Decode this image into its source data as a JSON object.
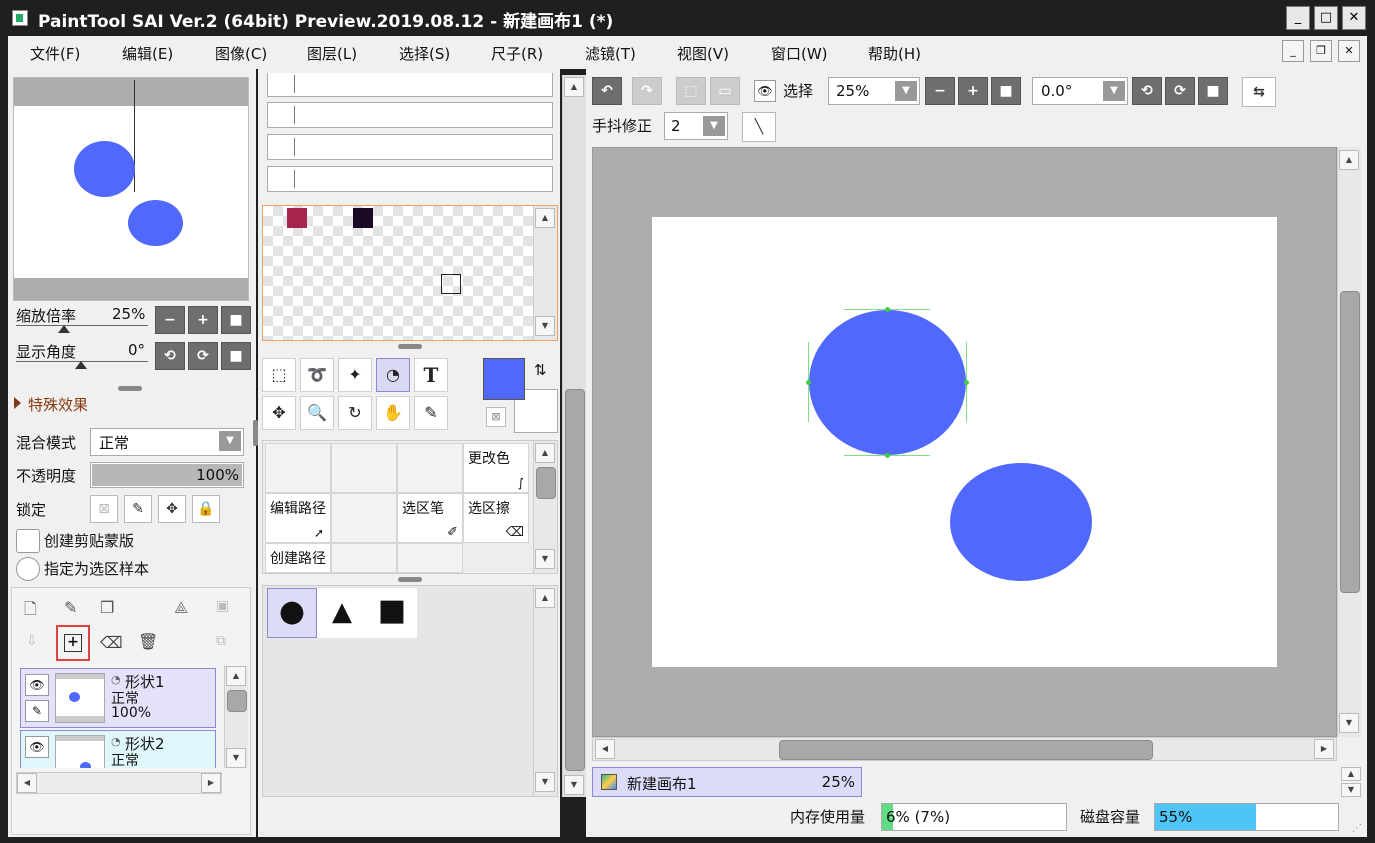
{
  "window": {
    "title": "PaintTool SAI Ver.2 (64bit) Preview.2019.08.12 - 新建画布1 (*)",
    "min": "_",
    "max": "□",
    "close": "✕"
  },
  "menu": [
    {
      "label": "文件(F)"
    },
    {
      "label": "编辑(E)"
    },
    {
      "label": "图像(C)"
    },
    {
      "label": "图层(L)"
    },
    {
      "label": "选择(S)"
    },
    {
      "label": "尺子(R)"
    },
    {
      "label": "滤镜(T)"
    },
    {
      "label": "视图(V)"
    },
    {
      "label": "窗口(W)"
    },
    {
      "label": "帮助(H)"
    }
  ],
  "mdi": {
    "min": "_",
    "restore": "❐",
    "close": "✕"
  },
  "navigator": {
    "zoom_label": "缩放倍率",
    "zoom_value": "25%",
    "angle_label": "显示角度",
    "angle_value": "0°",
    "zoom_out": "−",
    "zoom_in": "+",
    "zoom_reset": "■",
    "rot_ccw": "⟲",
    "rot_cw": "⟳",
    "rot_reset": "■"
  },
  "effects": {
    "label": "特殊效果"
  },
  "layer_props": {
    "blend_label": "混合模式",
    "blend_value": "正常",
    "opacity_label": "不透明度",
    "opacity_value": "100%",
    "opacity_fraction": 1.0,
    "lock_label": "锁定",
    "clip_label": "创建剪贴蒙版",
    "sel_sample_label": "指定为选区样本"
  },
  "layers": [
    {
      "name": "形状1",
      "mode": "正常",
      "opacity": "100%"
    },
    {
      "name": "形状2",
      "mode": "正常"
    }
  ],
  "swatches": {
    "colors": [
      "#a8264d",
      "#1a0a24"
    ]
  },
  "colors": {
    "primary": "#5068fc",
    "secondary": "#ffffff",
    "canvas_gray": "#adadad"
  },
  "tools": {
    "rect_select": "⬚",
    "lasso": "➰",
    "magic_wand": "✦",
    "shape": "◔",
    "text": "T",
    "move": "✥",
    "zoom": "🔍",
    "rotate": "↻",
    "hand": "✋",
    "eyedropper": "✎"
  },
  "sub_tools": [
    {
      "label": "更改色"
    },
    {
      "label": "编辑路径"
    },
    {
      "label": "选区笔"
    },
    {
      "label": "选区擦"
    },
    {
      "label": "创建路径"
    }
  ],
  "shapes": {
    "circle": "●",
    "triangle": "▲",
    "square": "■"
  },
  "toolbar": {
    "select_label": "选择",
    "zoom_value": "25%",
    "angle_value": "0.0°",
    "stabilizer_label": "手抖修正",
    "stabilizer_value": "2",
    "undo": "↶",
    "redo": "↷",
    "minus": "−",
    "plus": "+",
    "reset": "■",
    "rot_ccw": "⟲",
    "rot_cw": "⟳",
    "rot_reset": "■",
    "flip": "⇆",
    "line": "╲"
  },
  "canvas_tab": {
    "name": "新建画布1",
    "zoom": "25%"
  },
  "status": {
    "memory_label": "内存使用量",
    "memory_value": "6% (7%)",
    "memory_fraction": 0.06,
    "disk_label": "磁盘容量",
    "disk_value": "55%",
    "disk_fraction": 0.55
  }
}
